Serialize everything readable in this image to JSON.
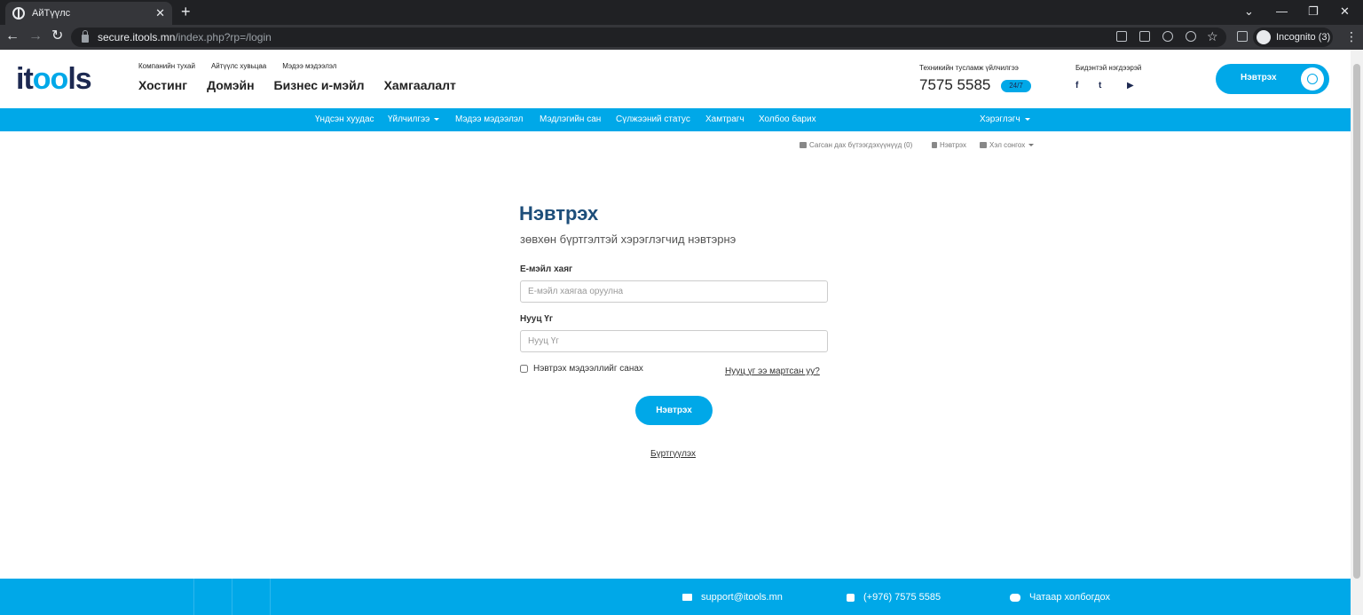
{
  "browser": {
    "tab_title": "АйТүүлс",
    "new_tab": "+",
    "url_host": "secure.itools.mn",
    "url_path": "/index.php?rp=/login",
    "profile_label": "Incognito (3)"
  },
  "header": {
    "logo_prefix": "it",
    "logo_oo": "oo",
    "logo_suffix": "ls",
    "top_links": [
      "Компанийн тухай",
      "Айтүүлс хувьцаа",
      "Мэдээ мэдээлэл"
    ],
    "main_links": [
      "Хостинг",
      "Домэйн",
      "Бизнес и-мэйл",
      "Хамгаалалт"
    ],
    "support_label": "Техникийн тусламж үйлчилгээ",
    "phone": "7575 5585",
    "badge": "24/7",
    "social_label": "Бидэнтэй нэгдээрэй",
    "social": [
      "f",
      "t",
      "▶"
    ],
    "login_button": "Нэвтрэх"
  },
  "nav": {
    "items": [
      "Үндсэн хуудас",
      "Үйлчилгээ",
      "Мэдээ мэдээлэл",
      "Мэдлэгийн сан",
      "Сүлжээний статус",
      "Хамтрагч",
      "Холбоо барих"
    ],
    "user_menu": "Хэрэглэгч"
  },
  "subnav": {
    "cart": "Сагсан дах бүтээгдэхүүнүүд (0)",
    "login": "Нэвтрэх",
    "language": "Хэл сонгох"
  },
  "login_form": {
    "title": "Нэвтрэх",
    "subtitle": "зөвхөн бүртгэлтэй хэрэглэгчид нэвтэрнэ",
    "email_label": "Е-мэйл хаяг",
    "email_placeholder": "Е-мэйл хаягаа оруулна",
    "password_label": "Нууц Үг",
    "password_placeholder": "Нууц Үг",
    "remember_label": "Нэвтрэх мэдээллийг санах",
    "forgot_link": "Нууц үг ээ мартсан уу?",
    "submit": "Нэвтрэх",
    "register_link": "Бүртгүүлэх"
  },
  "footer": {
    "email": "support@itools.mn",
    "phone": "(+976) 7575 5585",
    "chat": "Чатаар холбогдох"
  },
  "colors": {
    "brand_blue": "#00a8e8",
    "navy": "#1d2951"
  }
}
